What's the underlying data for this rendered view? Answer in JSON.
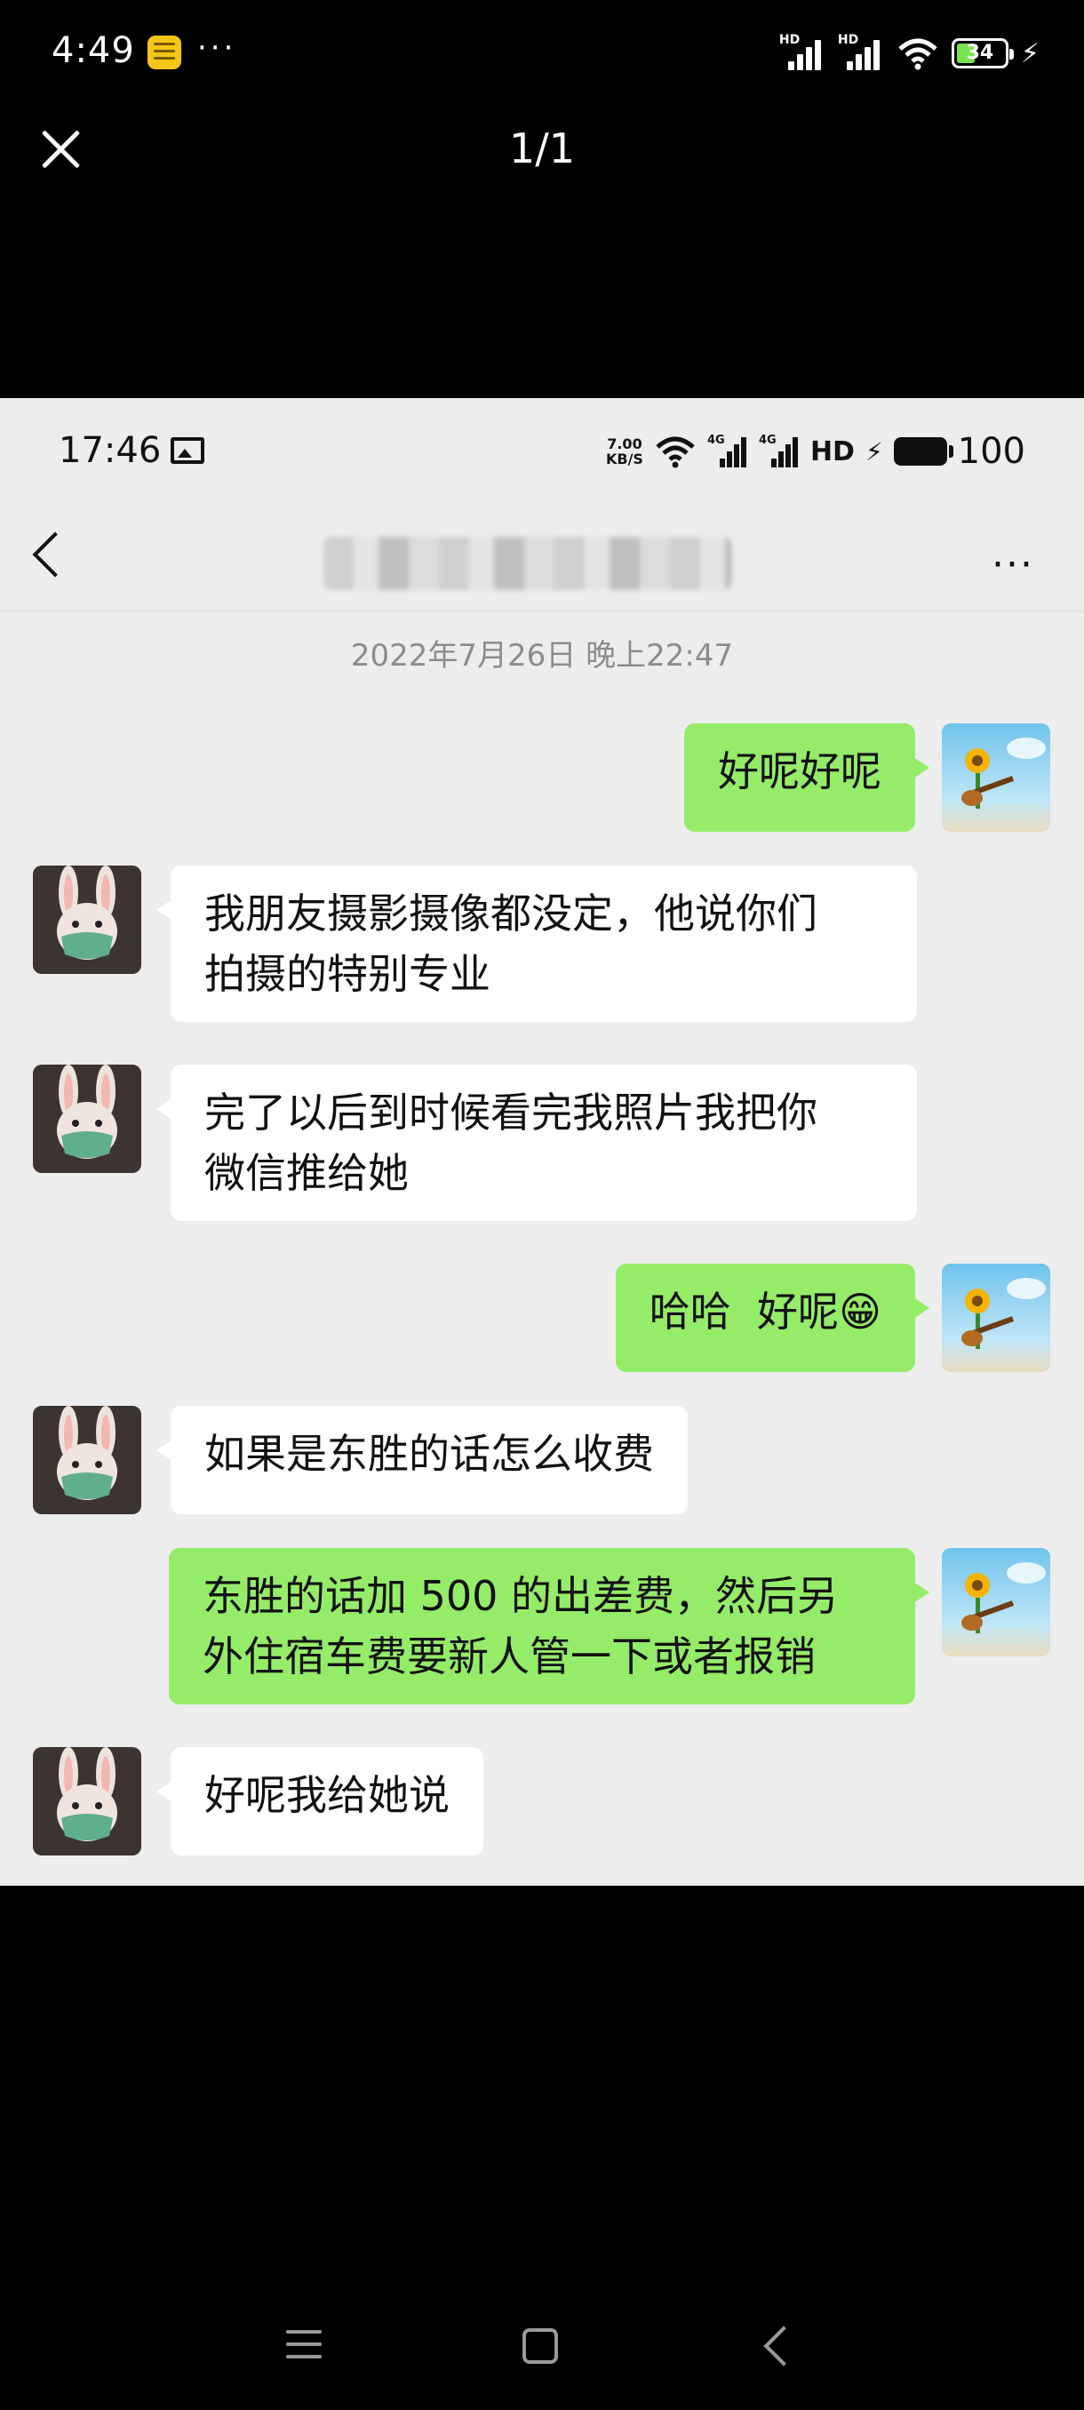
{
  "outer_status": {
    "time": "4:49",
    "more": "···",
    "battery": "34"
  },
  "viewer": {
    "counter": "1/1"
  },
  "inner_status": {
    "time": "17:46",
    "speed_top": "7.00",
    "speed_unit": "KB/S",
    "net1": "4G",
    "net2": "4G",
    "hd": "HD",
    "battery": "100"
  },
  "chat": {
    "more": "···",
    "timestamp": "2022年7月26日 晚上22:47",
    "messages": [
      {
        "sender": "me",
        "text": "好呢好呢"
      },
      {
        "sender": "them",
        "text": "我朋友摄影摄像都没定，他说你们\n拍摄的特别专业"
      },
      {
        "sender": "them",
        "text": "完了以后到时候看完我照片我把你\n微信推给她"
      },
      {
        "sender": "me",
        "text": "哈哈  好呢😁"
      },
      {
        "sender": "them",
        "text": "如果是东胜的话怎么收费"
      },
      {
        "sender": "me",
        "text": "东胜的话加 500 的出差费，然后另\n外住宿车费要新人管一下或者报销"
      },
      {
        "sender": "them",
        "text": "好呢我给她说"
      }
    ]
  },
  "colors": {
    "my_bubble": "#95ec69",
    "their_bubble": "#ffffff",
    "chat_bg": "#ededed"
  },
  "icons": {
    "close": "close-icon",
    "back": "back-chevron-icon",
    "more": "more-dots-icon"
  }
}
